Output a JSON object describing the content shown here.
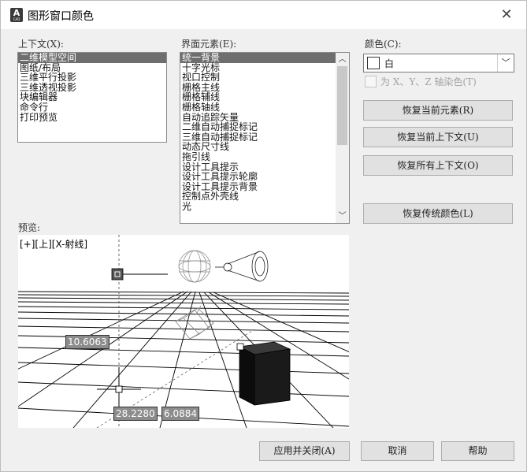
{
  "window": {
    "title": "图形窗口颜色",
    "app_icon": {
      "letter": "A",
      "caption": "CAD"
    },
    "close_icon": "close-icon"
  },
  "context": {
    "label": "上下文(X):",
    "items": [
      "二维模型空间",
      "图纸/布局",
      "三维平行投影",
      "三维透视投影",
      "块编辑器",
      "命令行",
      "打印预览"
    ],
    "selected": "二维模型空间"
  },
  "elements": {
    "label": "界面元素(E):",
    "items": [
      "统一背景",
      "十字光标",
      "视口控制",
      "栅格主线",
      "栅格辅线",
      "栅格轴线",
      "自动追踪矢量",
      "二维自动捕捉标记",
      "三维自动捕捉标记",
      "动态尺寸线",
      "拖引线",
      "设计工具提示",
      "设计工具提示轮廓",
      "设计工具提示背景",
      "控制点外壳线",
      "光"
    ],
    "selected": "统一背景"
  },
  "color": {
    "label": "颜色(C):",
    "value": "白",
    "swatch": "#ffffff",
    "tint_checkbox_label": "为 X、Y、Z 轴染色(T)",
    "tint_checked": false
  },
  "buttons": {
    "restore_element": "恢复当前元素(R)",
    "restore_context": "恢复当前上下文(U)",
    "restore_all": "恢复所有上下文(O)",
    "restore_classic": "恢复传统颜色(L)",
    "apply_close": "应用并关闭(A)",
    "cancel": "取消",
    "help": "帮助"
  },
  "preview": {
    "label": "预览:",
    "view_label": "[+][上][X-射线]",
    "coord_left": "10.6063",
    "coord_x": "28.2280",
    "coord_y": "6.0884"
  },
  "colors": {
    "selection": "#6e6e6e",
    "tooltip_bg": "#8c8c8c",
    "cube": "#111111"
  }
}
